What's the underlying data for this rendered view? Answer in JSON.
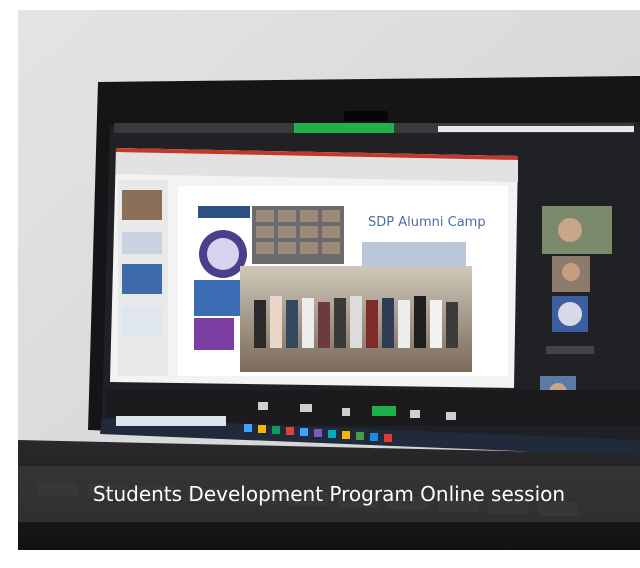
{
  "photo": {
    "description_icon": "laptop-video-call-photo",
    "slide_title": "SDP Alumni Camp",
    "caption": "Students Development Program Online session"
  },
  "colors": {
    "wall": "#dcdcdc",
    "laptop_body": "#1c1c1e",
    "screen_frame": "#0f0f10",
    "slide_accent": "#c0392b",
    "meeting_bar_green": "#1fb24a",
    "end_call_red": "#e53935",
    "caption_bg": "#3a3a3a"
  }
}
